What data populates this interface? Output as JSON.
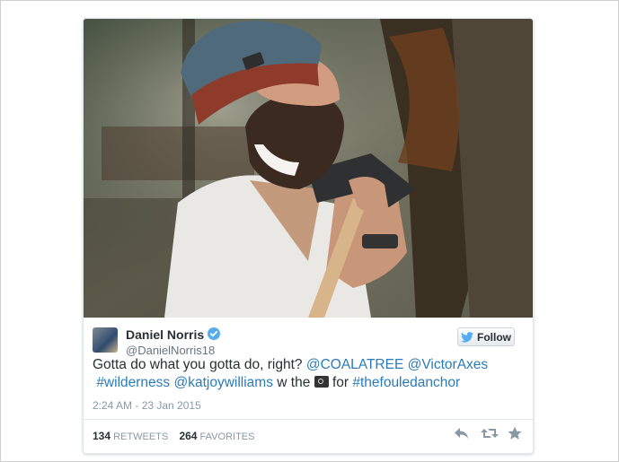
{
  "tweet": {
    "author_name": "Daniel Norris",
    "author_handle": "@DanielNorris18",
    "follow_label": "Follow",
    "text_parts": {
      "p1": "Gotta do what you gotta do, right? ",
      "mention1": "@COALATREE",
      "sp1": " ",
      "mention2": "@VictorAxes",
      "hashtag1": "#wilderness",
      "sp2": " ",
      "mention3": "@katjoywilliams",
      "p2": " w the ",
      "p3": " for ",
      "hashtag2": "#thefouledanchor"
    },
    "timestamp": "2:24 AM - 23 Jan 2015",
    "retweets_count": "134",
    "retweets_label": "RETWEETS",
    "favorites_count": "264",
    "favorites_label": "FAVORITES"
  },
  "icons": {
    "verified": "verified-badge-icon",
    "follow": "twitter-bird-icon",
    "camera": "camera-emoji-icon",
    "reply": "reply-icon",
    "retweet": "retweet-icon",
    "favorite": "star-icon"
  },
  "colors": {
    "link": "#2b7bb9",
    "text": "#292f33",
    "muted": "#8899a6",
    "verified": "#55acee"
  }
}
